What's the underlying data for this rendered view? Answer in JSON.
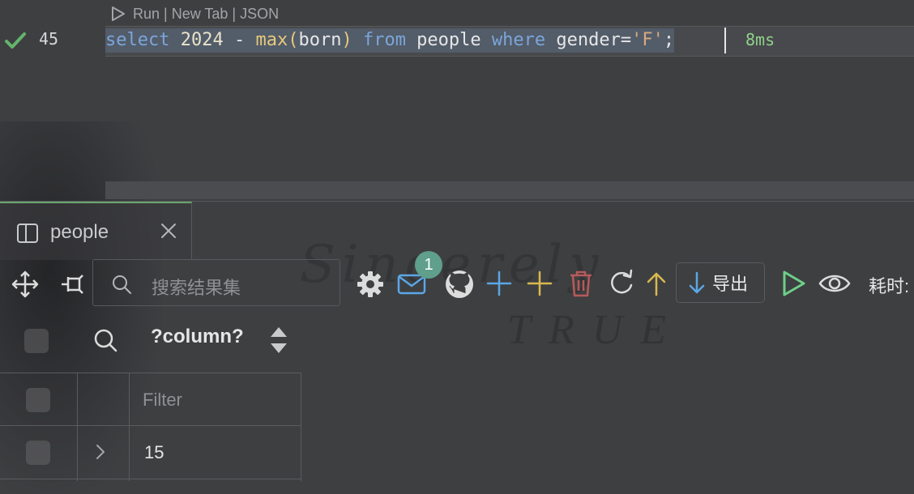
{
  "editor": {
    "codelens": "Run | New Tab | JSON",
    "line_number": "45",
    "code": {
      "t1": "select",
      "t2": " ",
      "t3": "2024",
      "t4": " - ",
      "t5": "max",
      "t6": "(",
      "t7": "born",
      "t8": ")",
      "t9": " ",
      "t10": "from",
      "t11": " people ",
      "t12": "where",
      "t13": " gender=",
      "t14": "'F'",
      "t15": ";"
    },
    "timing": "8ms"
  },
  "panel": {
    "tab_label": "people",
    "search_placeholder": "搜索结果集",
    "notification_count": "1",
    "export_label": "导出",
    "elapsed_label": "耗时:",
    "column_name": "?column?",
    "filter_placeholder": "Filter",
    "rows": [
      {
        "value": "15"
      }
    ]
  },
  "background": {
    "script_text": "Sincerely",
    "true_text": "TRUE"
  },
  "colors": {
    "accent_green": "#6aa56f",
    "keyword_blue": "#7aa6da",
    "function_yellow": "#e7c97b",
    "add_blue": "#5aa7e6",
    "add_yellow": "#d9b94e",
    "delete_red": "#b85a5a"
  }
}
